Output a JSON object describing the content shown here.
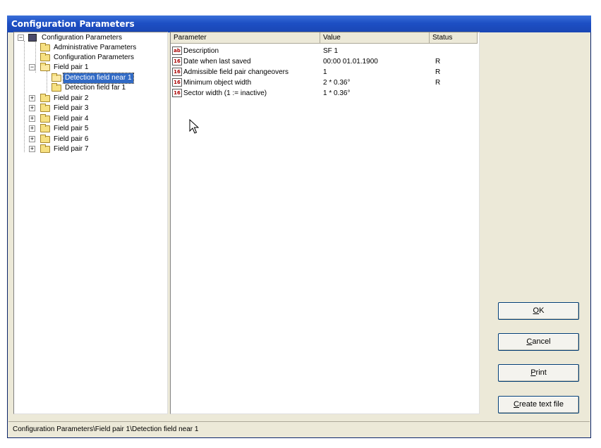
{
  "window": {
    "title": "Configuration Parameters"
  },
  "tree": {
    "root": "Configuration Parameters",
    "items": [
      {
        "label": "Administrative Parameters"
      },
      {
        "label": "Configuration Parameters"
      },
      {
        "label": "Field pair 1"
      },
      {
        "label": "Detection field near 1"
      },
      {
        "label": "Detection field far 1"
      },
      {
        "label": "Field pair 2"
      },
      {
        "label": "Field pair 3"
      },
      {
        "label": "Field pair 4"
      },
      {
        "label": "Field pair 5"
      },
      {
        "label": "Field pair 6"
      },
      {
        "label": "Field pair 7"
      }
    ],
    "toggle_expanded": "−",
    "toggle_collapsed": "+"
  },
  "list": {
    "columns": [
      "Parameter",
      "Value",
      "Status"
    ],
    "rows": [
      {
        "icon": "ab",
        "parameter": "Description",
        "value": "SF 1",
        "status": ""
      },
      {
        "icon": "16",
        "parameter": "Date when last saved",
        "value": "00:00 01.01.1900",
        "status": "R"
      },
      {
        "icon": "16",
        "parameter": "Admissible field pair changeovers",
        "value": "1",
        "status": "R"
      },
      {
        "icon": "16",
        "parameter": "Minimum object width",
        "value": "2 * 0.36°",
        "status": "R"
      },
      {
        "icon": "16",
        "parameter": "Sector width (1 := inactive)",
        "value": "1 * 0.36°",
        "status": ""
      }
    ]
  },
  "buttons": {
    "ok": {
      "mnemonic": "O",
      "rest": "K"
    },
    "cancel": {
      "mnemonic": "C",
      "rest": "ancel"
    },
    "print": {
      "mnemonic": "P",
      "rest": "rint"
    },
    "create": {
      "mnemonic": "C",
      "rest": "reate text file"
    }
  },
  "status": {
    "path": "Configuration Parameters\\Field pair 1\\Detection field near 1"
  },
  "colors": {
    "titlebar": "#1d4fc4",
    "selection": "#316ac5",
    "face": "#ece9d8"
  }
}
